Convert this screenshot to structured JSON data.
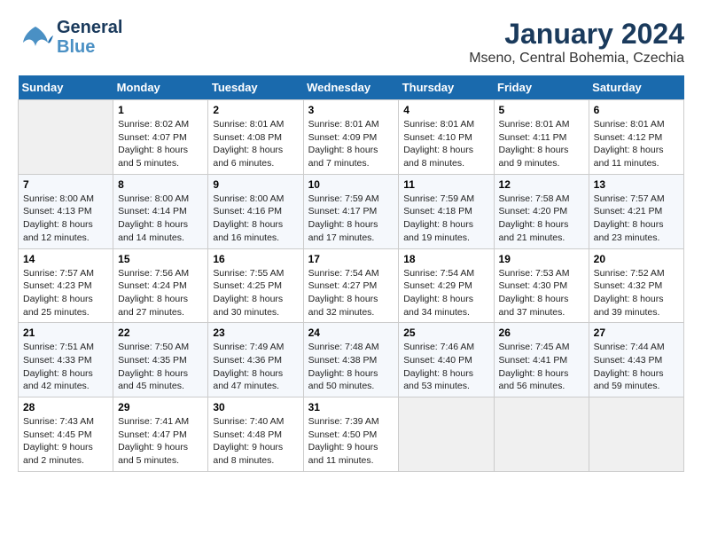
{
  "header": {
    "logo_general": "General",
    "logo_blue": "Blue",
    "title": "January 2024",
    "subtitle": "Mseno, Central Bohemia, Czechia"
  },
  "days_of_week": [
    "Sunday",
    "Monday",
    "Tuesday",
    "Wednesday",
    "Thursday",
    "Friday",
    "Saturday"
  ],
  "weeks": [
    [
      {
        "num": "",
        "empty": true
      },
      {
        "num": "1",
        "sunrise": "8:02 AM",
        "sunset": "4:07 PM",
        "daylight": "8 hours and 5 minutes."
      },
      {
        "num": "2",
        "sunrise": "8:01 AM",
        "sunset": "4:08 PM",
        "daylight": "8 hours and 6 minutes."
      },
      {
        "num": "3",
        "sunrise": "8:01 AM",
        "sunset": "4:09 PM",
        "daylight": "8 hours and 7 minutes."
      },
      {
        "num": "4",
        "sunrise": "8:01 AM",
        "sunset": "4:10 PM",
        "daylight": "8 hours and 8 minutes."
      },
      {
        "num": "5",
        "sunrise": "8:01 AM",
        "sunset": "4:11 PM",
        "daylight": "8 hours and 9 minutes."
      },
      {
        "num": "6",
        "sunrise": "8:01 AM",
        "sunset": "4:12 PM",
        "daylight": "8 hours and 11 minutes."
      }
    ],
    [
      {
        "num": "7",
        "sunrise": "8:00 AM",
        "sunset": "4:13 PM",
        "daylight": "8 hours and 12 minutes."
      },
      {
        "num": "8",
        "sunrise": "8:00 AM",
        "sunset": "4:14 PM",
        "daylight": "8 hours and 14 minutes."
      },
      {
        "num": "9",
        "sunrise": "8:00 AM",
        "sunset": "4:16 PM",
        "daylight": "8 hours and 16 minutes."
      },
      {
        "num": "10",
        "sunrise": "7:59 AM",
        "sunset": "4:17 PM",
        "daylight": "8 hours and 17 minutes."
      },
      {
        "num": "11",
        "sunrise": "7:59 AM",
        "sunset": "4:18 PM",
        "daylight": "8 hours and 19 minutes."
      },
      {
        "num": "12",
        "sunrise": "7:58 AM",
        "sunset": "4:20 PM",
        "daylight": "8 hours and 21 minutes."
      },
      {
        "num": "13",
        "sunrise": "7:57 AM",
        "sunset": "4:21 PM",
        "daylight": "8 hours and 23 minutes."
      }
    ],
    [
      {
        "num": "14",
        "sunrise": "7:57 AM",
        "sunset": "4:23 PM",
        "daylight": "8 hours and 25 minutes."
      },
      {
        "num": "15",
        "sunrise": "7:56 AM",
        "sunset": "4:24 PM",
        "daylight": "8 hours and 27 minutes."
      },
      {
        "num": "16",
        "sunrise": "7:55 AM",
        "sunset": "4:25 PM",
        "daylight": "8 hours and 30 minutes."
      },
      {
        "num": "17",
        "sunrise": "7:54 AM",
        "sunset": "4:27 PM",
        "daylight": "8 hours and 32 minutes."
      },
      {
        "num": "18",
        "sunrise": "7:54 AM",
        "sunset": "4:29 PM",
        "daylight": "8 hours and 34 minutes."
      },
      {
        "num": "19",
        "sunrise": "7:53 AM",
        "sunset": "4:30 PM",
        "daylight": "8 hours and 37 minutes."
      },
      {
        "num": "20",
        "sunrise": "7:52 AM",
        "sunset": "4:32 PM",
        "daylight": "8 hours and 39 minutes."
      }
    ],
    [
      {
        "num": "21",
        "sunrise": "7:51 AM",
        "sunset": "4:33 PM",
        "daylight": "8 hours and 42 minutes."
      },
      {
        "num": "22",
        "sunrise": "7:50 AM",
        "sunset": "4:35 PM",
        "daylight": "8 hours and 45 minutes."
      },
      {
        "num": "23",
        "sunrise": "7:49 AM",
        "sunset": "4:36 PM",
        "daylight": "8 hours and 47 minutes."
      },
      {
        "num": "24",
        "sunrise": "7:48 AM",
        "sunset": "4:38 PM",
        "daylight": "8 hours and 50 minutes."
      },
      {
        "num": "25",
        "sunrise": "7:46 AM",
        "sunset": "4:40 PM",
        "daylight": "8 hours and 53 minutes."
      },
      {
        "num": "26",
        "sunrise": "7:45 AM",
        "sunset": "4:41 PM",
        "daylight": "8 hours and 56 minutes."
      },
      {
        "num": "27",
        "sunrise": "7:44 AM",
        "sunset": "4:43 PM",
        "daylight": "8 hours and 59 minutes."
      }
    ],
    [
      {
        "num": "28",
        "sunrise": "7:43 AM",
        "sunset": "4:45 PM",
        "daylight": "9 hours and 2 minutes."
      },
      {
        "num": "29",
        "sunrise": "7:41 AM",
        "sunset": "4:47 PM",
        "daylight": "9 hours and 5 minutes."
      },
      {
        "num": "30",
        "sunrise": "7:40 AM",
        "sunset": "4:48 PM",
        "daylight": "9 hours and 8 minutes."
      },
      {
        "num": "31",
        "sunrise": "7:39 AM",
        "sunset": "4:50 PM",
        "daylight": "9 hours and 11 minutes."
      },
      {
        "num": "",
        "empty": true
      },
      {
        "num": "",
        "empty": true
      },
      {
        "num": "",
        "empty": true
      }
    ]
  ],
  "labels": {
    "sunrise": "Sunrise:",
    "sunset": "Sunset:",
    "daylight": "Daylight:"
  }
}
